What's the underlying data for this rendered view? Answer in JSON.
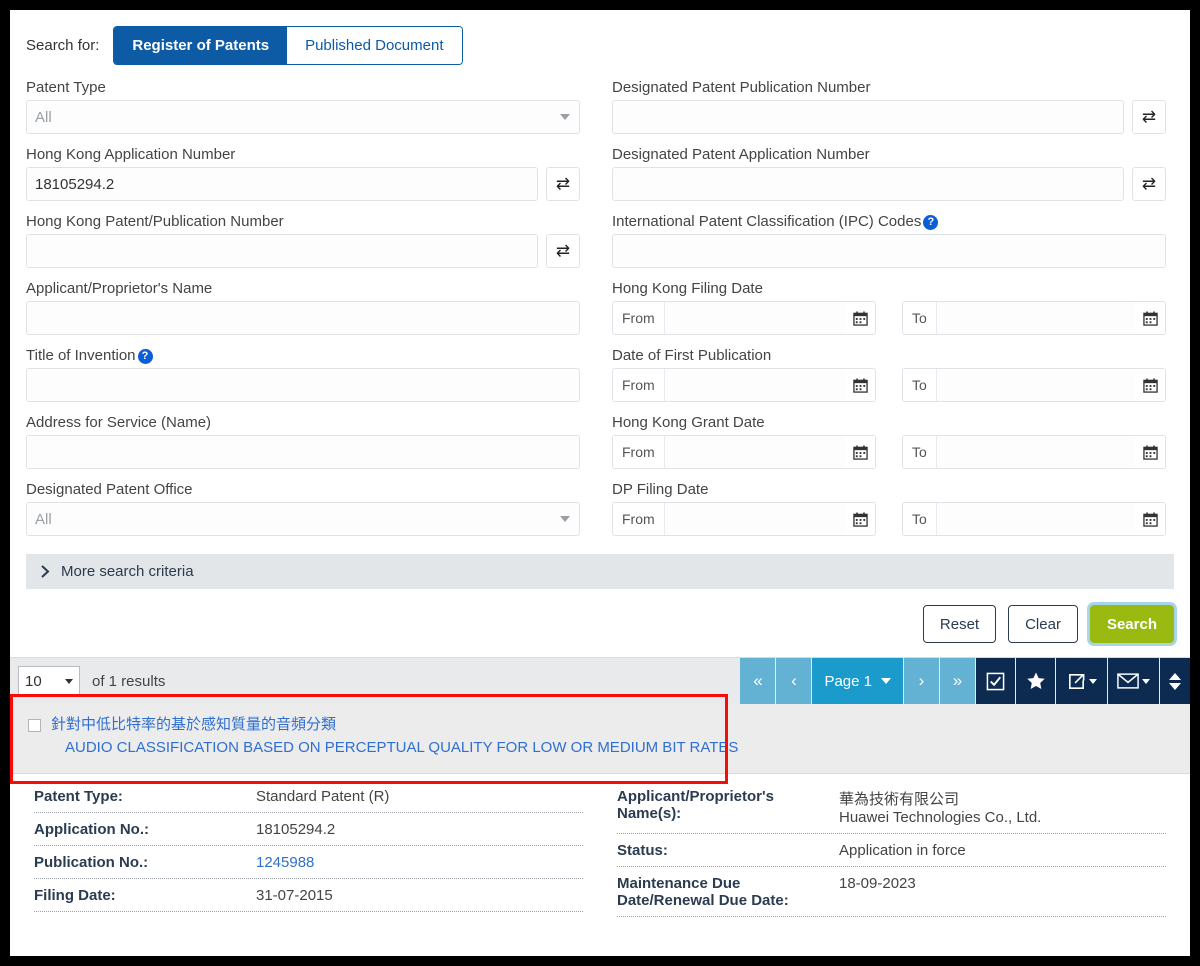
{
  "search": {
    "search_for_label": "Search for:",
    "tabs": [
      {
        "label": "Register of Patents",
        "active": true
      },
      {
        "label": "Published Document",
        "active": false
      }
    ],
    "left_fields": {
      "patent_type": {
        "label": "Patent Type",
        "value": "All"
      },
      "hk_application_number": {
        "label": "Hong Kong Application Number",
        "value": "18105294.2"
      },
      "hk_patent_publication_number": {
        "label": "Hong Kong Patent/Publication Number",
        "value": ""
      },
      "applicant_name": {
        "label": "Applicant/Proprietor's Name",
        "value": ""
      },
      "title_of_invention": {
        "label": "Title of Invention",
        "value": "",
        "help": "?"
      },
      "address_for_service": {
        "label": "Address for Service (Name)",
        "value": ""
      },
      "designated_patent_office": {
        "label": "Designated Patent Office",
        "value": "All"
      }
    },
    "right_fields": {
      "dp_publication_number": {
        "label": "Designated Patent Publication Number",
        "value": ""
      },
      "dp_application_number": {
        "label": "Designated Patent Application Number",
        "value": ""
      },
      "ipc_codes": {
        "label": "International Patent Classification (IPC) Codes",
        "value": "",
        "help": "?"
      },
      "hk_filing_date": {
        "label": "Hong Kong Filing Date",
        "from_label": "From",
        "to_label": "To",
        "from_value": "",
        "to_value": ""
      },
      "date_first_publication": {
        "label": "Date of First Publication",
        "from_label": "From",
        "to_label": "To",
        "from_value": "",
        "to_value": ""
      },
      "hk_grant_date": {
        "label": "Hong Kong Grant Date",
        "from_label": "From",
        "to_label": "To",
        "from_value": "",
        "to_value": ""
      },
      "dp_filing_date": {
        "label": "DP Filing Date",
        "from_label": "From",
        "to_label": "To",
        "from_value": "",
        "to_value": ""
      }
    },
    "more_criteria_label": "More search criteria",
    "buttons": {
      "reset": "Reset",
      "clear": "Clear",
      "search": "Search"
    },
    "swap_icon": "⇄"
  },
  "results": {
    "page_size": "10",
    "count_label": "of 1 results",
    "pagination": {
      "first": "«",
      "prev": "‹",
      "page_label": "Page 1",
      "next": "›",
      "last": "»"
    },
    "actions": {
      "select_all": "select-all-checkbox-icon",
      "favourite": "star-icon",
      "export": "share-icon",
      "email": "envelope-icon"
    },
    "row": {
      "title_cn": "針對中低比特率的基於感知質量的音頻分類",
      "title_en": "AUDIO CLASSIFICATION BASED ON PERCEPTUAL QUALITY FOR LOW OR MEDIUM BIT RATES"
    },
    "detail_left": [
      {
        "key": "Patent Type:",
        "value": "Standard Patent (R)",
        "link": false
      },
      {
        "key": "Application No.:",
        "value": "18105294.2",
        "link": false
      },
      {
        "key": "Publication No.:",
        "value": "1245988",
        "link": true
      },
      {
        "key": "Filing Date:",
        "value": "31-07-2015",
        "link": false
      }
    ],
    "detail_right": [
      {
        "key": "Applicant/Proprietor's Name(s):",
        "value": "華為技術有限公司\nHuawei Technologies Co., Ltd.",
        "link": false
      },
      {
        "key": "Status:",
        "value": "Application in force",
        "link": false
      },
      {
        "key": "Maintenance Due Date/Renewal Due Date:",
        "value": "18-09-2023",
        "link": false
      }
    ]
  },
  "colors": {
    "tab_active": "#0d5ba5",
    "search_button": "#9aba12",
    "link": "#2f6fd0",
    "toolbar_dark": "#0d2b50",
    "pagination": "#63b2d4",
    "highlight_box": "#fb0b07"
  }
}
